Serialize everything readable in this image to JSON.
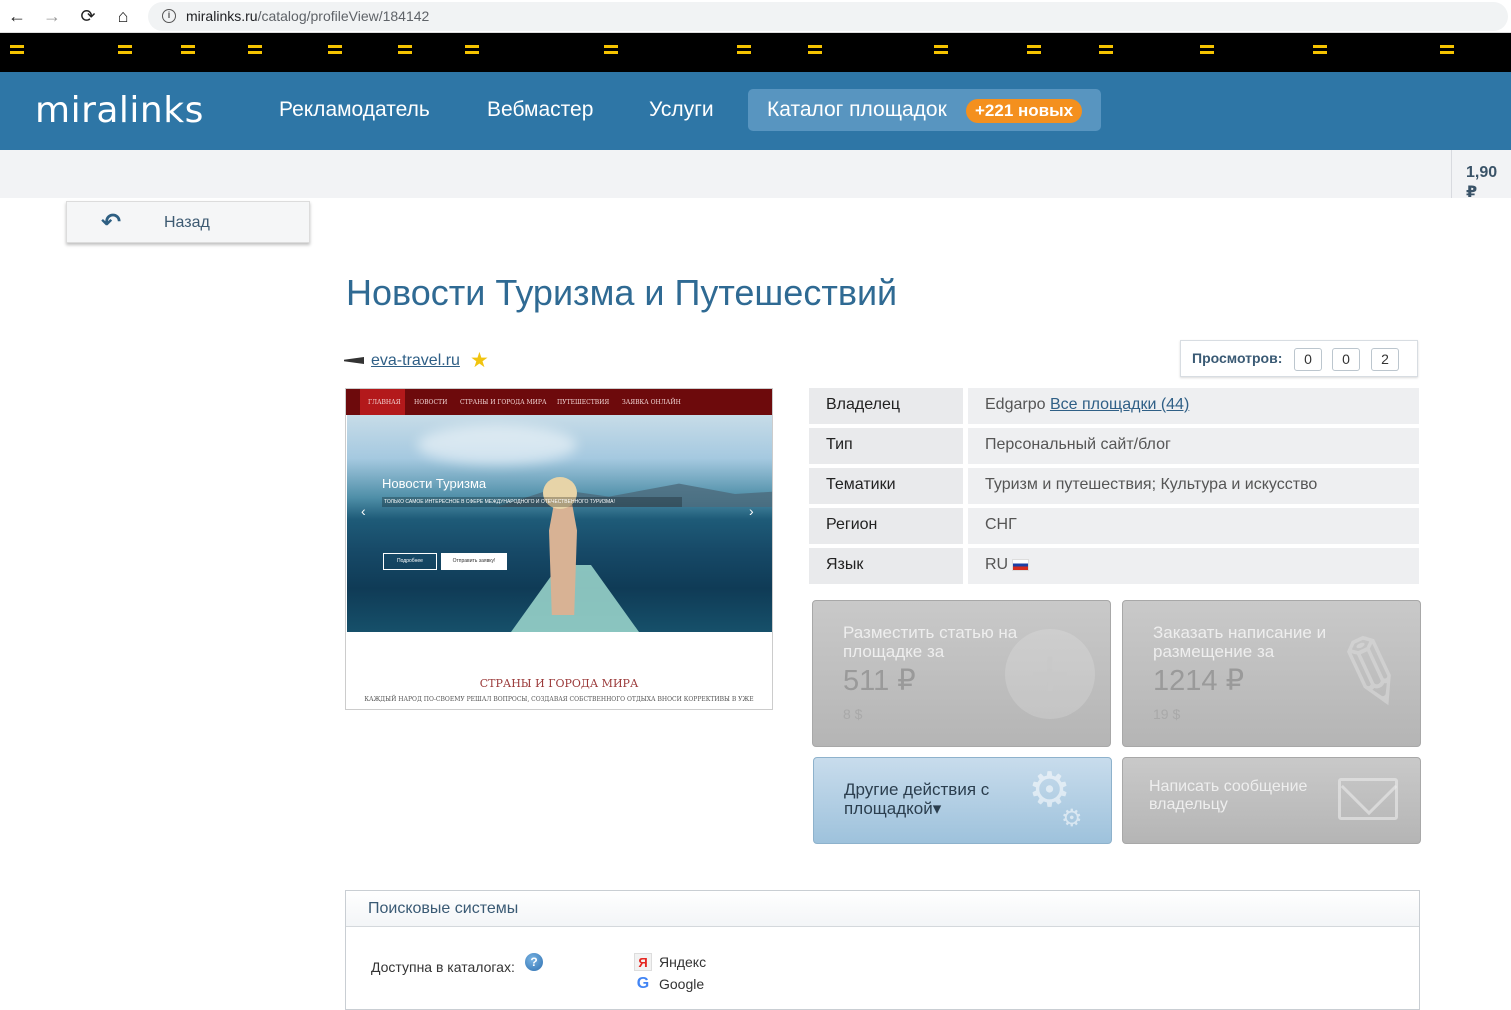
{
  "browser": {
    "url_host": "miralinks.ru",
    "url_path": "/catalog/profileView/184142"
  },
  "header": {
    "logo": "miralinks",
    "nav": [
      "Рекламодатель",
      "Вебмастер",
      "Услуги"
    ],
    "catalog_label": "Каталог площадок",
    "catalog_badge": "+221 новых"
  },
  "subbar": {
    "balance": "1,90 ₽"
  },
  "back_label": "Назад",
  "site": {
    "title": "Новости Туризма и Путешествий",
    "domain": "eva-travel.ru"
  },
  "views": {
    "label": "Просмотров:",
    "counts": [
      "0",
      "0",
      "2"
    ]
  },
  "preview": {
    "nav": [
      "ГЛАВНАЯ",
      "НОВОСТИ",
      "СТРАНЫ И ГОРОДА МИРА",
      "ПУТЕШЕСТВИЯ",
      "ЗАЯВКА ОНЛАЙН"
    ],
    "hero_title": "Новости Туризма",
    "hero_sub": "ТОЛЬКО САМОЕ ИНТЕРЕСНОЕ В СФЕРЕ МЕЖДУНАРОДНОГО И ОТЕЧЕСТВЕННОГО ТУРИЗМА!",
    "btn_more": "Подробнее",
    "btn_send": "Отправить заявку!",
    "section_title": "СТРАНЫ И ГОРОДА МИРА",
    "section_text": "КАЖДЫЙ НАРОД ПО-СВОЕМУ РЕШАЛ ВОПРОСЫ, СОЗДАВАЯ СОБСТВЕННОГО ОТДЫХА ВНОСИ КОРРЕКТИВЫ В УЖЕ"
  },
  "info": {
    "owner_label": "Владелец",
    "owner_name": "Edgarpo",
    "owner_link": "Все площадки (44)",
    "type_label": "Тип",
    "type_value": "Персональный сайт/блог",
    "topics_label": "Тематики",
    "topics_value": "Туризм и путешествия; Культура и искусство",
    "region_label": "Регион",
    "region_value": "СНГ",
    "lang_label": "Язык",
    "lang_value": "RU"
  },
  "actions": {
    "place_title": "Разместить статью на площадке за",
    "place_price": "511 ₽",
    "place_usd": "8 $",
    "order_title": "Заказать написание и размещение за",
    "order_price": "1214 ₽",
    "order_usd": "19 $",
    "other_title": "Другие действия с площадкой▾",
    "message_title": "Написать сообщение владельцу"
  },
  "search_engines": {
    "header": "Поисковые системы",
    "available_label": "Доступна в каталогах:",
    "engines": [
      "Яндекс",
      "Google"
    ]
  }
}
